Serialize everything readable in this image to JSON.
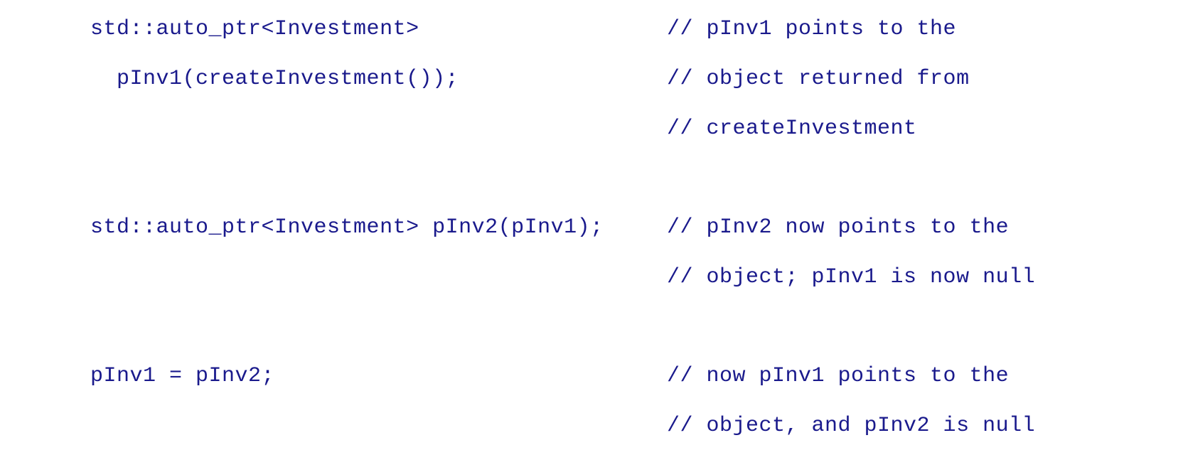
{
  "code_lines": [
    {
      "code": "std::auto_ptr<Investment>",
      "comment": "// pInv1 points to the"
    },
    {
      "code": "pInv1(createInvestment());",
      "comment": "// object returned from"
    },
    {
      "code": "",
      "comment": "// createInvestment"
    },
    {
      "code": "std::auto_ptr<Investment> pInv2(pInv1);",
      "comment": "// pInv2 now points to the"
    },
    {
      "code": "",
      "comment": "// object; pInv1 is now null"
    },
    {
      "code": "pInv1 = pInv2;",
      "comment": "// now pInv1 points to the"
    },
    {
      "code": "",
      "comment": "// object, and pInv2 is null"
    }
  ]
}
